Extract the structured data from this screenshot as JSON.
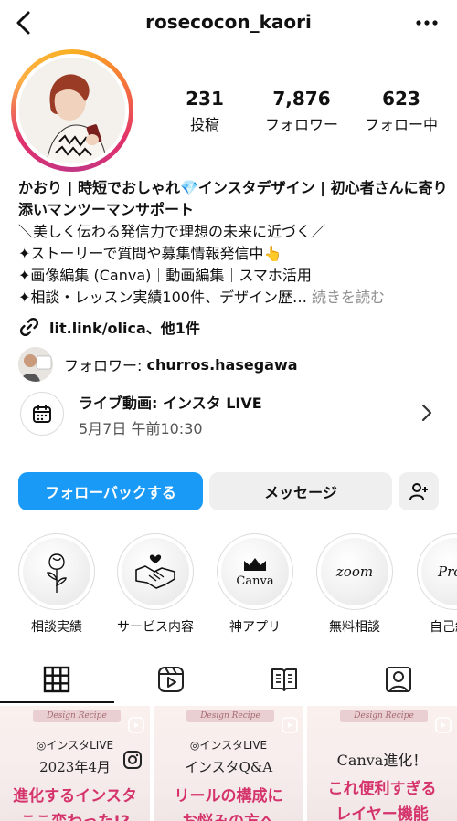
{
  "header": {
    "username": "rosecocon_kaori",
    "back_icon": "chevron-left-icon",
    "more_icon": "more-horizontal-icon"
  },
  "stats": [
    {
      "value": "231",
      "label": "投稿"
    },
    {
      "value": "7,876",
      "label": "フォロワー"
    },
    {
      "value": "623",
      "label": "フォロー中"
    }
  ],
  "bio": {
    "name_line": "かおり | 時短でおしゃれ💎インスタデザイン | 初心者さんに寄り添いマンツーマンサポート",
    "line1": "＼美しく伝わる発信力で理想の未来に近づく／",
    "line2": "✦ストーリーで質問や募集情報発信中👆",
    "line3": "✦画像編集 (Canva)｜動画編集｜スマホ活用",
    "line4": "✦相談・レッスン実績100件、デザイン歴…",
    "more_label": "続きを読む"
  },
  "link": {
    "text": "lit.link/olica、他1件"
  },
  "followed_by": {
    "prefix": "フォロワー: ",
    "account": "churros.hasegawa"
  },
  "live_event": {
    "title": "ライブ動画: インスタ LIVE",
    "datetime": "5月7日 午前10:30"
  },
  "buttons": {
    "follow_back": "フォローバックする",
    "message": "メッセージ"
  },
  "highlights": [
    {
      "label": "相談実績",
      "icon": "rose-icon"
    },
    {
      "label": "サービス内容",
      "icon": "handshake-icon"
    },
    {
      "label": "神アプリ",
      "icon": "crown-icon",
      "text": "Canva"
    },
    {
      "label": "無料相談",
      "icon": "zoom-text",
      "text": "zoom"
    },
    {
      "label": "自己紹",
      "icon": "profile-text",
      "text": "Prof"
    }
  ],
  "tabs": [
    "grid-icon",
    "reels-icon",
    "guides-icon",
    "tagged-icon"
  ],
  "posts": [
    {
      "tag": "Design Recipe",
      "sub": "◎インスタLIVE",
      "big": "2023年4月",
      "pink": "進化するインスタ",
      "pink2": "ここ変わった!?"
    },
    {
      "tag": "Design Recipe",
      "sub": "◎インスタLIVE",
      "big": "インスタQ&A",
      "pink": "リールの構成に",
      "pink2": "お悩みの方へ"
    },
    {
      "tag": "Design Recipe",
      "sub": "",
      "big": "Canva進化！",
      "pink": "これ便利すぎる",
      "pink2": "レイヤー機能"
    }
  ],
  "colors": {
    "accent": "#1a9af7",
    "pink": "#d5336b"
  }
}
